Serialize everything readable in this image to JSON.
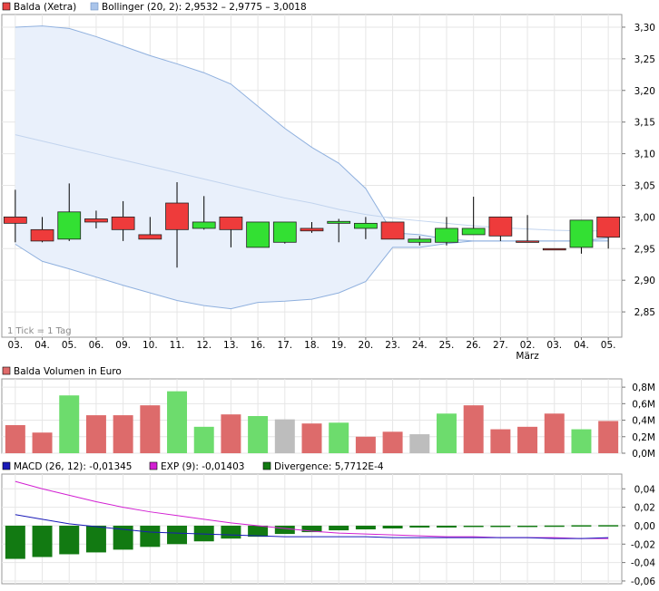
{
  "chart_data": [
    {
      "type": "candlestick",
      "legend": [
        {
          "label": "Balda (Xetra)",
          "color": "#e84545"
        },
        {
          "label": "Bollinger (20, 2): 2,9532 – 2,9775 – 3,0018",
          "color": "#a9c4ea"
        }
      ],
      "note": "1 Tick = 1 Tag",
      "x_labels": [
        "03.",
        "04.",
        "05.",
        "06.",
        "09.",
        "10.",
        "11.",
        "12.",
        "13.",
        "16.",
        "17.",
        "18.",
        "19.",
        "20.",
        "23.",
        "24.",
        "25.",
        "26.",
        "27.",
        "02.",
        "03.",
        "04.",
        "05."
      ],
      "x_sublabels": {
        "19": "März"
      },
      "y_ticks": [
        "3,30",
        "3,25",
        "3,20",
        "3,15",
        "3,10",
        "3,05",
        "3,00",
        "2,95",
        "2,90",
        "2,85"
      ],
      "y_tick_values": [
        3.3,
        3.25,
        3.2,
        3.15,
        3.1,
        3.05,
        3.0,
        2.95,
        2.9,
        2.85
      ],
      "ylim": [
        2.81,
        3.32
      ],
      "candles": [
        {
          "o": 3.0,
          "h": 3.043,
          "l": 2.96,
          "c": 2.99
        },
        {
          "o": 2.98,
          "h": 3.0,
          "l": 2.96,
          "c": 2.962
        },
        {
          "o": 2.965,
          "h": 3.053,
          "l": 2.962,
          "c": 3.008
        },
        {
          "o": 2.997,
          "h": 3.01,
          "l": 2.982,
          "c": 2.992
        },
        {
          "o": 3.0,
          "h": 3.025,
          "l": 2.962,
          "c": 2.98
        },
        {
          "o": 2.972,
          "h": 3.0,
          "l": 2.965,
          "c": 2.965
        },
        {
          "o": 3.022,
          "h": 3.055,
          "l": 2.92,
          "c": 2.98
        },
        {
          "o": 2.982,
          "h": 3.033,
          "l": 2.98,
          "c": 2.992
        },
        {
          "o": 3.0,
          "h": 3.0,
          "l": 2.952,
          "c": 2.98
        },
        {
          "o": 2.952,
          "h": 2.992,
          "l": 2.952,
          "c": 2.992
        },
        {
          "o": 2.96,
          "h": 2.992,
          "l": 2.958,
          "c": 2.992
        },
        {
          "o": 2.982,
          "h": 2.992,
          "l": 2.975,
          "c": 2.978
        },
        {
          "o": 2.99,
          "h": 2.997,
          "l": 2.96,
          "c": 2.993
        },
        {
          "o": 2.982,
          "h": 3.0,
          "l": 2.965,
          "c": 2.99
        },
        {
          "o": 2.992,
          "h": 2.992,
          "l": 2.965,
          "c": 2.965
        },
        {
          "o": 2.96,
          "h": 2.97,
          "l": 2.955,
          "c": 2.965
        },
        {
          "o": 2.96,
          "h": 3.0,
          "l": 2.955,
          "c": 2.982
        },
        {
          "o": 2.972,
          "h": 3.032,
          "l": 2.972,
          "c": 2.982
        },
        {
          "o": 3.0,
          "h": 3.0,
          "l": 2.962,
          "c": 2.97
        },
        {
          "o": 2.962,
          "h": 3.003,
          "l": 2.96,
          "c": 2.96
        },
        {
          "o": 2.95,
          "h": 2.95,
          "l": 2.948,
          "c": 2.949
        },
        {
          "o": 2.952,
          "h": 2.995,
          "l": 2.942,
          "c": 2.995
        },
        {
          "o": 3.0,
          "h": 3.0,
          "l": 2.95,
          "c": 2.968
        }
      ],
      "bollinger": {
        "upper": [
          3.3,
          3.302,
          3.298,
          3.285,
          3.27,
          3.255,
          3.242,
          3.228,
          3.21,
          3.175,
          3.14,
          3.11,
          3.085,
          3.045,
          2.975,
          2.972,
          2.965,
          2.962,
          2.962,
          2.962,
          2.962,
          2.962,
          2.967
        ],
        "middle": [
          3.13,
          3.12,
          3.11,
          3.1,
          3.09,
          3.08,
          3.07,
          3.06,
          3.05,
          3.04,
          3.03,
          3.022,
          3.012,
          3.004,
          2.998,
          2.994,
          2.99,
          2.986,
          2.983,
          2.981,
          2.979,
          2.978,
          2.978
        ],
        "lower": [
          2.957,
          2.93,
          2.918,
          2.905,
          2.892,
          2.88,
          2.868,
          2.86,
          2.855,
          2.865,
          2.867,
          2.87,
          2.88,
          2.898,
          2.952,
          2.952,
          2.958,
          2.962,
          2.962,
          2.962,
          2.962,
          2.962,
          2.962
        ]
      }
    },
    {
      "type": "bar",
      "legend": [
        {
          "label": "Balda Volumen in Euro",
          "color": "#e06b6b"
        }
      ],
      "y_ticks": [
        "0,8M",
        "0,6M",
        "0,4M",
        "0,2M",
        "0,0M"
      ],
      "y_tick_values": [
        0.8,
        0.6,
        0.4,
        0.2,
        0.0
      ],
      "ylim": [
        0,
        0.9
      ],
      "values": [
        0.34,
        0.25,
        0.7,
        0.46,
        0.46,
        0.58,
        0.75,
        0.32,
        0.47,
        0.45,
        0.41,
        0.36,
        0.37,
        0.2,
        0.26,
        0.23,
        0.48,
        0.58,
        0.29,
        0.32,
        0.48,
        0.29,
        0.39
      ],
      "colors": [
        "red",
        "red",
        "green",
        "red",
        "red",
        "red",
        "green",
        "green",
        "red",
        "green",
        "grey",
        "red",
        "green",
        "red",
        "red",
        "grey",
        "green",
        "red",
        "red",
        "red",
        "red",
        "green",
        "red"
      ]
    },
    {
      "type": "line+bar",
      "legend": [
        {
          "label": "MACD (26, 12): -0,01345",
          "color": "#1a1ab8"
        },
        {
          "label": "EXP (9): -0,01403",
          "color": "#d21fd2"
        },
        {
          "label": "Divergence: 5,7712E-4",
          "color": "#127a12"
        }
      ],
      "y_ticks": [
        "0,04",
        "0,02",
        "0,00",
        "-0,02",
        "-0,04",
        "-0,06"
      ],
      "y_tick_values": [
        0.04,
        0.02,
        0.0,
        -0.02,
        -0.04,
        -0.06
      ],
      "ylim": [
        -0.063,
        0.056
      ],
      "macd": [
        0.012,
        0.007,
        0.002,
        -0.001,
        -0.004,
        -0.007,
        -0.008,
        -0.009,
        -0.01,
        -0.011,
        -0.012,
        -0.012,
        -0.012,
        -0.012,
        -0.013,
        -0.013,
        -0.013,
        -0.013,
        -0.013,
        -0.013,
        -0.014,
        -0.014,
        -0.013
      ],
      "exp": [
        0.048,
        0.04,
        0.033,
        0.026,
        0.02,
        0.015,
        0.011,
        0.007,
        0.003,
        0.0,
        -0.003,
        -0.006,
        -0.008,
        -0.009,
        -0.01,
        -0.011,
        -0.012,
        -0.012,
        -0.013,
        -0.013,
        -0.013,
        -0.014,
        -0.014
      ],
      "divergence": [
        -0.036,
        -0.034,
        -0.031,
        -0.029,
        -0.026,
        -0.023,
        -0.02,
        -0.017,
        -0.014,
        -0.012,
        -0.009,
        -0.007,
        -0.005,
        -0.004,
        -0.003,
        -0.002,
        -0.002,
        -0.001,
        -0.001,
        -0.0005,
        0.0002,
        0.0005,
        0.0006
      ]
    }
  ]
}
